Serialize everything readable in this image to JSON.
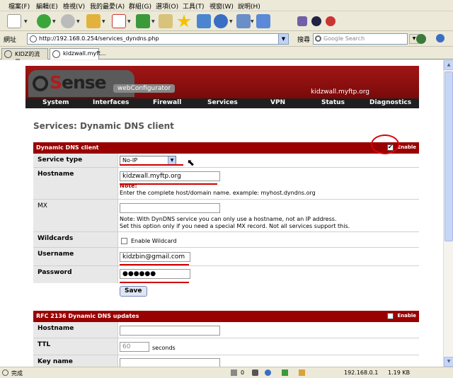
{
  "menu": [
    "檔案(F)",
    "編輯(E)",
    "檢視(V)",
    "我的最愛(A)",
    "群組(G)",
    "選項(O)",
    "工具(T)",
    "視窗(W)",
    "說明(H)"
  ],
  "address": {
    "label": "網址",
    "url": "http://192.168.0.254/services_dyndns.php"
  },
  "search": {
    "label": "搜尋",
    "placeholder": "Google Search"
  },
  "tabs": [
    {
      "label": "KIDZ的流量..."
    },
    {
      "label": "kidzwall.myft..."
    }
  ],
  "header": {
    "webconf": "webConfigurator",
    "hostname": "kidzwall.myftp.org"
  },
  "nav": [
    "System",
    "Interfaces",
    "Firewall",
    "Services",
    "VPN",
    "Status",
    "Diagnostics"
  ],
  "page_title": "Services: Dynamic DNS client",
  "dyndns": {
    "section": "Dynamic DNS client",
    "enable": "Enable",
    "service_type": {
      "label": "Service type",
      "value": "No-IP"
    },
    "hostname": {
      "label": "Hostname",
      "value": "kidzwall.myftp.org",
      "note_key": "Note:",
      "note": "Enter the complete host/domain name. example: myhost.dyndns.org"
    },
    "mx": {
      "label": "MX",
      "value": "",
      "note1": "Note: With DynDNS service you can only use a hostname, not an IP address.",
      "note2": "Set this option only if you need a special MX record. Not all services support this."
    },
    "wildcards": {
      "label": "Wildcards",
      "option": "Enable Wildcard"
    },
    "username": {
      "label": "Username",
      "value": "kidzbin@gmail.com"
    },
    "password": {
      "label": "Password",
      "value": "●●●●●●"
    },
    "save": "Save"
  },
  "rfc2136": {
    "section": "RFC 2136 Dynamic DNS updates",
    "enable": "Enable",
    "hostname": {
      "label": "Hostname"
    },
    "ttl": {
      "label": "TTL",
      "value": "60",
      "unit": "seconds"
    },
    "key_name": {
      "label": "Key name"
    }
  },
  "status": {
    "text": "完成",
    "count": "0",
    "ip": "192.168.0.1",
    "size": "1.19 KB"
  }
}
